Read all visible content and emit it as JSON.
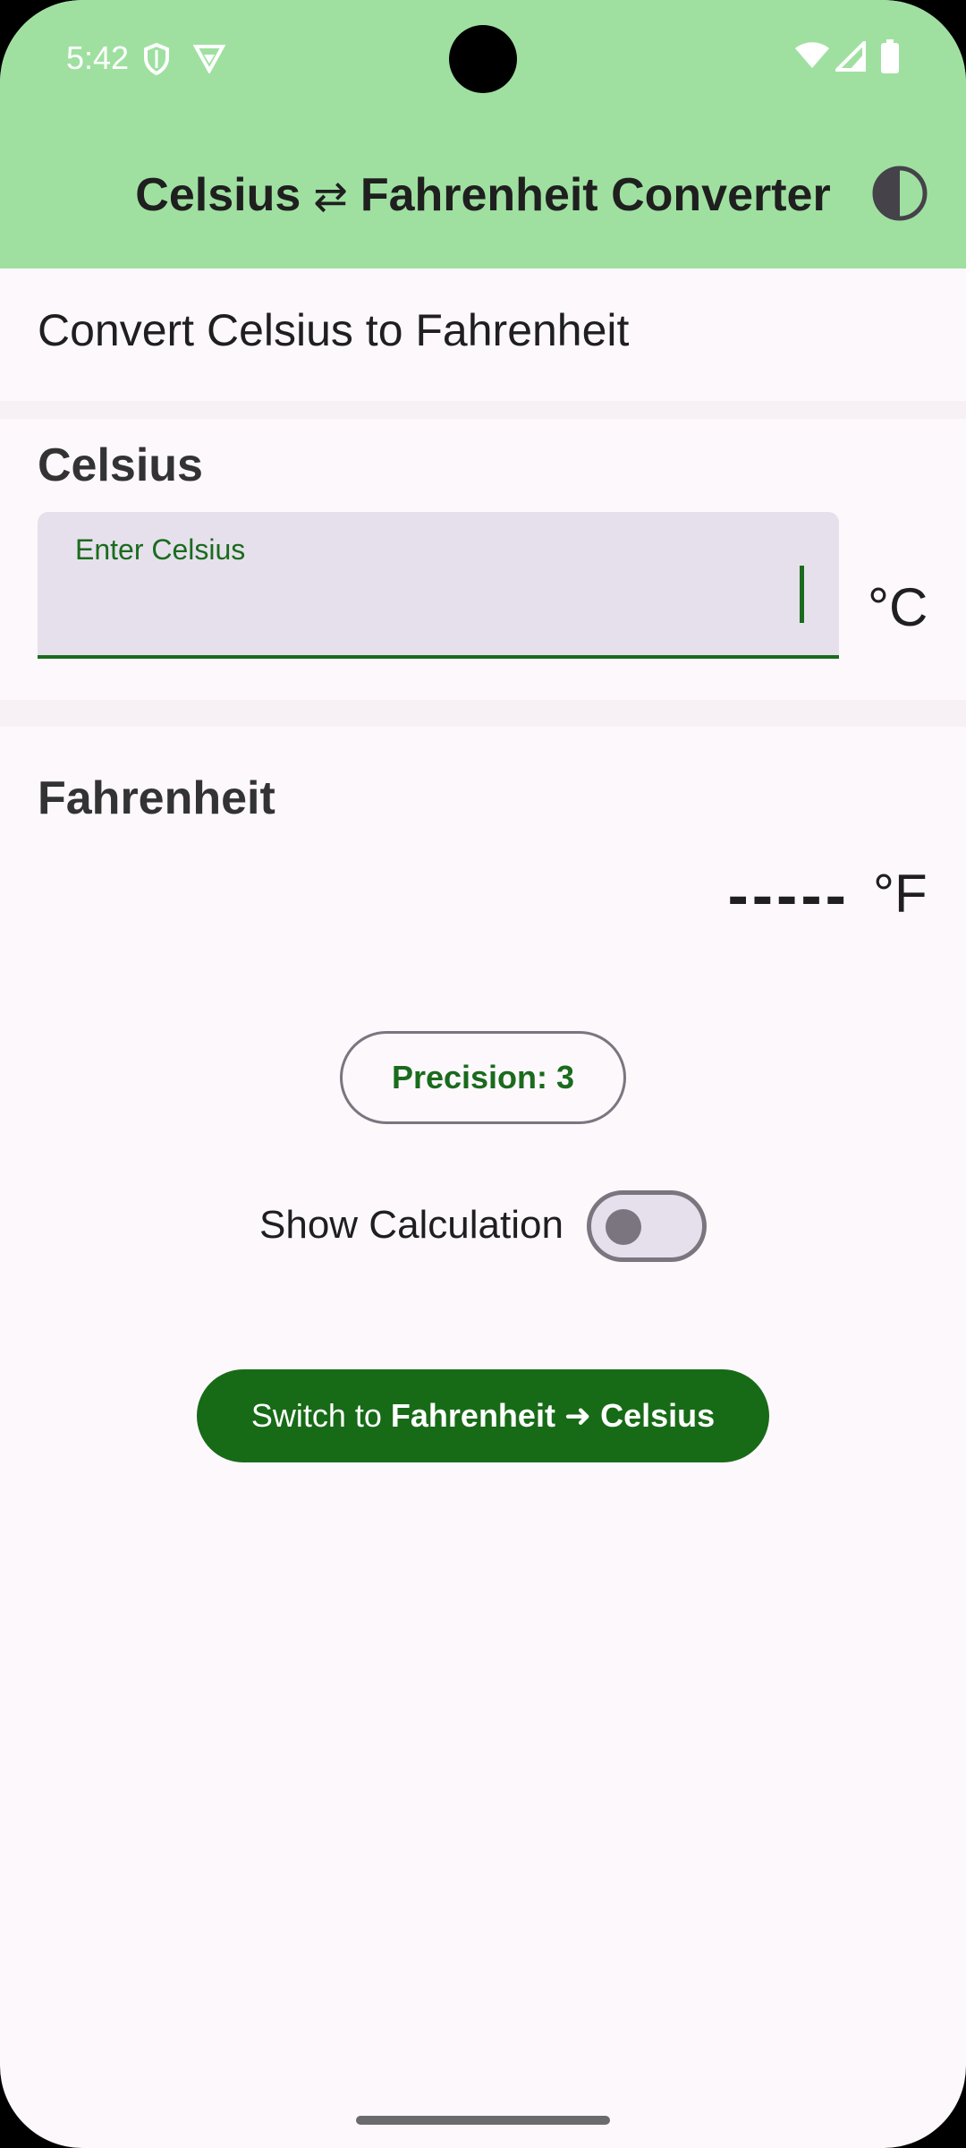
{
  "status_bar": {
    "time": "5:42",
    "left_icons": [
      "shield-icon",
      "vpn-icon"
    ],
    "right_icons": [
      "wifi-icon",
      "cellular-signal-icon",
      "battery-icon"
    ]
  },
  "app_bar": {
    "title_left": "Celsius",
    "title_arrows": "⇄",
    "title_right": "Fahrenheit Converter",
    "theme_icon": "contrast-icon",
    "color": "#9fe0a1"
  },
  "mode": {
    "text": "Convert Celsius to Fahrenheit"
  },
  "celsius": {
    "title": "Celsius",
    "input_label": "Enter Celsius",
    "input_value": "",
    "unit": "°C"
  },
  "fahrenheit": {
    "title": "Fahrenheit",
    "result": "-----",
    "unit": "°F"
  },
  "controls": {
    "precision_label": "Precision: 3",
    "show_calculation_label": "Show Calculation",
    "show_calculation_on": false,
    "switch_prefix": "Switch to ",
    "switch_target": "Fahrenheit ➜ Celsius"
  },
  "colors": {
    "primary": "#176b17",
    "accent_text": "#1a6b1d",
    "surface": "#fdf8fc",
    "input_fill": "#e6e0ec"
  }
}
